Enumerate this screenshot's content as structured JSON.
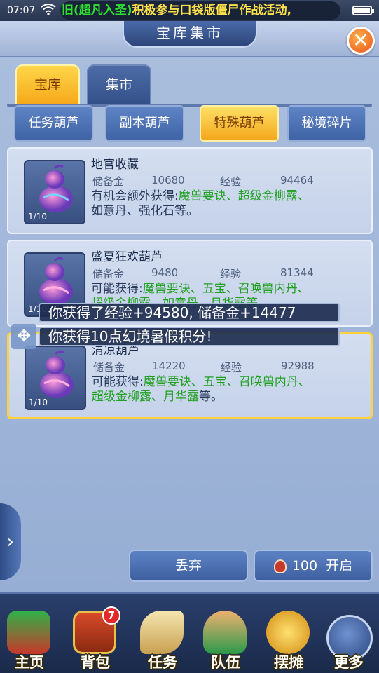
{
  "statusbar": {
    "time": "07:07",
    "marquee_green": "旧(超凡入圣)",
    "marquee_yellow": "积极参与口袋版僵尸作战活动,",
    "battery_level_percent": 90
  },
  "header": {
    "title": "宝库集市"
  },
  "tabs": [
    {
      "label": "宝库"
    },
    {
      "label": "集市"
    }
  ],
  "categories": [
    {
      "label": "任务葫芦"
    },
    {
      "label": "副本葫芦"
    },
    {
      "label": "特殊葫芦"
    },
    {
      "label": "秘境碎片"
    }
  ],
  "cards": [
    {
      "name": "地官收藏",
      "reserve_label": "储备金",
      "reserve": "10680",
      "exp_label": "经验",
      "exp": "94464",
      "desc_prefix": "有机会额外获得:",
      "desc_green": "魔兽要诀、超级金柳露、",
      "desc_rest": "如意丹、强化石等。",
      "count": "1/10"
    },
    {
      "name": "盛夏狂欢葫芦",
      "reserve_label": "储备金",
      "reserve": "9480",
      "exp_label": "经验",
      "exp": "81344",
      "desc_prefix": "可能获得:",
      "desc_green": "魔兽要诀、五宝、召唤兽内丹、",
      "desc_rest": "超级金柳露、如意丹、月华露等。",
      "count": "1/10"
    },
    {
      "name": "清凉葫芦",
      "reserve_label": "储备金",
      "reserve": "14220",
      "exp_label": "经验",
      "exp": "92988",
      "desc_prefix": "可能获得:",
      "desc_green": "魔兽要诀、五宝、召唤兽内丹、",
      "desc_green2": "超级金柳露、月华露",
      "desc_rest": "等。",
      "count": "1/10"
    }
  ],
  "toasts": [
    "你获得了经验+94580, 储备金+14477",
    "你获得10点幻境暑假积分!"
  ],
  "actions": {
    "discard_label": "丢弃",
    "open_cost": "100",
    "open_label": "开启"
  },
  "nav": [
    {
      "label": "主页",
      "icon": "home-pavilion-icon"
    },
    {
      "label": "背包",
      "icon": "treasure-chest-icon",
      "badge": "7"
    },
    {
      "label": "任务",
      "icon": "scroll-icon"
    },
    {
      "label": "队伍",
      "icon": "team-icon"
    },
    {
      "label": "摆摊",
      "icon": "coin-icon"
    },
    {
      "label": "更多",
      "icon": "more-icon"
    }
  ]
}
